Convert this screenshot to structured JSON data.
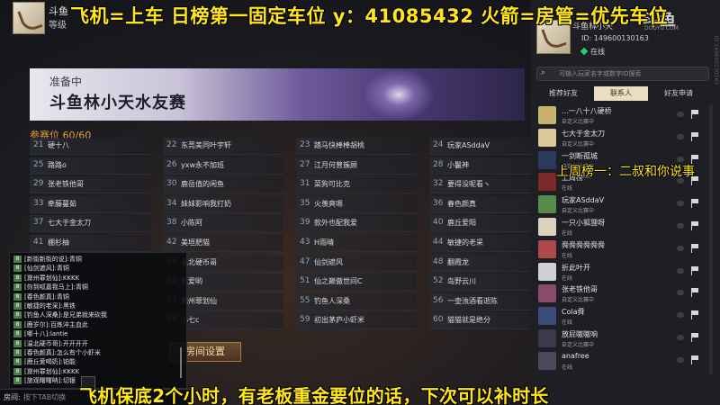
{
  "top_left": {
    "name": "斗鱼",
    "level": "等级"
  },
  "overlay": {
    "top_banner": "飞机=上车 日榜第一固定车位 y：41085432 火箭=房管=优先车位",
    "bottom_banner": "飞机保底2个小时，有老板重金要位的话，下次可以补时长",
    "side_banner": "上周榜一：二叔和你说事"
  },
  "event": {
    "status": "准备中",
    "title": "斗鱼林小天水友赛",
    "seats_label": "参赛位",
    "seats_value": "60/60"
  },
  "slots": [
    [
      {
        "n": "21",
        "name": "硬十八"
      },
      {
        "n": "22",
        "name": "东莞美同叶宇轩"
      },
      {
        "n": "23",
        "name": "踏马快棒棒胡桃"
      },
      {
        "n": "24",
        "name": "玩家ASddaV"
      }
    ],
    [
      {
        "n": "25",
        "name": "路路o"
      },
      {
        "n": "26",
        "name": "yxw永不加班"
      },
      {
        "n": "27",
        "name": "江月何曾簇顾"
      },
      {
        "n": "28",
        "name": "小鬣神"
      }
    ],
    [
      {
        "n": "29",
        "name": "张老铁他哥"
      },
      {
        "n": "30",
        "name": "鹿岳值的闲鱼"
      },
      {
        "n": "31",
        "name": "菜狗可比克"
      },
      {
        "n": "32",
        "name": "要得没呢看ヽ"
      }
    ],
    [
      {
        "n": "33",
        "name": "牵藤蔓茹"
      },
      {
        "n": "34",
        "name": "妹妹影响我打奶"
      },
      {
        "n": "35",
        "name": "火羡爽嗯"
      },
      {
        "n": "36",
        "name": "春色颜真"
      }
    ],
    [
      {
        "n": "37",
        "name": "七大于金太刀"
      },
      {
        "n": "38",
        "name": "小陈阿"
      },
      {
        "n": "39",
        "name": "款外也配我爱"
      },
      {
        "n": "40",
        "name": "鹿丘爱阳"
      }
    ],
    [
      {
        "n": "41",
        "name": "棚杉柚"
      },
      {
        "n": "42",
        "name": "美垣肥猫"
      },
      {
        "n": "43",
        "name": "H雨晴"
      },
      {
        "n": "44",
        "name": "敏捷的老采"
      }
    ],
    [
      {
        "n": "45",
        "name": ""
      },
      {
        "n": "46",
        "name": "温北硬币哥"
      },
      {
        "n": "47",
        "name": "仙剑遮风"
      },
      {
        "n": "48",
        "name": "翻霞龙"
      }
    ],
    [
      {
        "n": "49",
        "name": ""
      },
      {
        "n": "50",
        "name": "愿爱哟"
      },
      {
        "n": "51",
        "name": "仙之巅傲世间C"
      },
      {
        "n": "52",
        "name": "岛野云川"
      }
    ],
    [
      {
        "n": "53",
        "name": ""
      },
      {
        "n": "54",
        "name": "滁州罪划仙"
      },
      {
        "n": "55",
        "name": "钓鱼人深桑"
      },
      {
        "n": "56",
        "name": "一壶浊酒看逝陈"
      }
    ],
    [
      {
        "n": "57",
        "name": ""
      },
      {
        "n": "58",
        "name": "小七c"
      },
      {
        "n": "59",
        "name": "初出茅庐小虾米"
      },
      {
        "n": "60",
        "name": "猫猫就是绝分"
      }
    ]
  ],
  "room_settings_label": "房间设置",
  "chat": {
    "lines": [
      {
        "lv": "8",
        "text": "[新街新街的说]:青铜"
      },
      {
        "lv": "8",
        "text": "[仙剑遮风]:青铜"
      },
      {
        "lv": "8",
        "text": "[滁州罪划仙]:KKKK"
      },
      {
        "lv": "8",
        "text": "[你到呱嘉我马上]:青铜"
      },
      {
        "lv": "8",
        "text": "[春色颜真]:青铜"
      },
      {
        "lv": "8",
        "text": "[敏捷的老采]:黑铁"
      },
      {
        "lv": "8",
        "text": "[钓鱼人深桑]:是兄弟就来砍我"
      },
      {
        "lv": "8",
        "text": "[鹿岁尔]:百炼淬主血此"
      },
      {
        "lv": "8",
        "text": "[哪十八]:lantie"
      },
      {
        "lv": "8",
        "text": "[温北硬币哥]:开开开开"
      },
      {
        "lv": "8",
        "text": "[春色颜真]:怎么有个小虾米"
      },
      {
        "lv": "8",
        "text": "[鹿丘爱喝奶]:铂能"
      },
      {
        "lv": "8",
        "text": "[滁州罪划仙]:KKKK"
      },
      {
        "lv": "8",
        "text": "[旅观曙曙呐]:切银"
      }
    ],
    "input_label": "房间:",
    "input_placeholder": "按下TAB切换"
  },
  "right_panel": {
    "name": "斗鱼林小天",
    "id_text": "ID: 149600130163",
    "online": "在线",
    "logo": "斗鱼",
    "logo_sub": "DOUYU.COM",
    "watermark": "ID 149600130163",
    "search_placeholder": "可输入玩家名字或数字ID搜索",
    "tabs": [
      "推荐好友",
      "联系人",
      "好友申请"
    ],
    "friends": [
      {
        "name": "...一八十八硬桥",
        "status": "自定义比赛中",
        "color": "#c8b070"
      },
      {
        "name": "七大于金太刀",
        "status": "自定义比赛中",
        "color": "#d8c89a"
      },
      {
        "name": "一剑断孤城",
        "status": "自定义比赛中",
        "color": "#2a3a5a"
      },
      {
        "name": "上周榜一",
        "status": "在线",
        "color": "#7a2a2a"
      },
      {
        "name": "玩家ASddaV",
        "status": "自定义比赛中",
        "color": "#5a8a4a"
      },
      {
        "name": "一只小狐狸呀",
        "status": "在线",
        "color": "#dcd0c0"
      },
      {
        "name": "舜舜舜舜舜舜",
        "status": "在线",
        "color": "#b04a4a"
      },
      {
        "name": "折此叶开",
        "status": "在线",
        "color": "#d0d0d0"
      },
      {
        "name": "张老铁他哥",
        "status": "自定义比赛中",
        "color": "#8a4a6a"
      },
      {
        "name": "Cola舜",
        "status": "在线",
        "color": "#3a4a7a"
      },
      {
        "name": "放屁嗷嗷响",
        "status": "自定义比赛中",
        "color": "#3a3a4a"
      },
      {
        "name": "anafree",
        "status": "在线",
        "color": "#4a4a5a"
      }
    ]
  }
}
